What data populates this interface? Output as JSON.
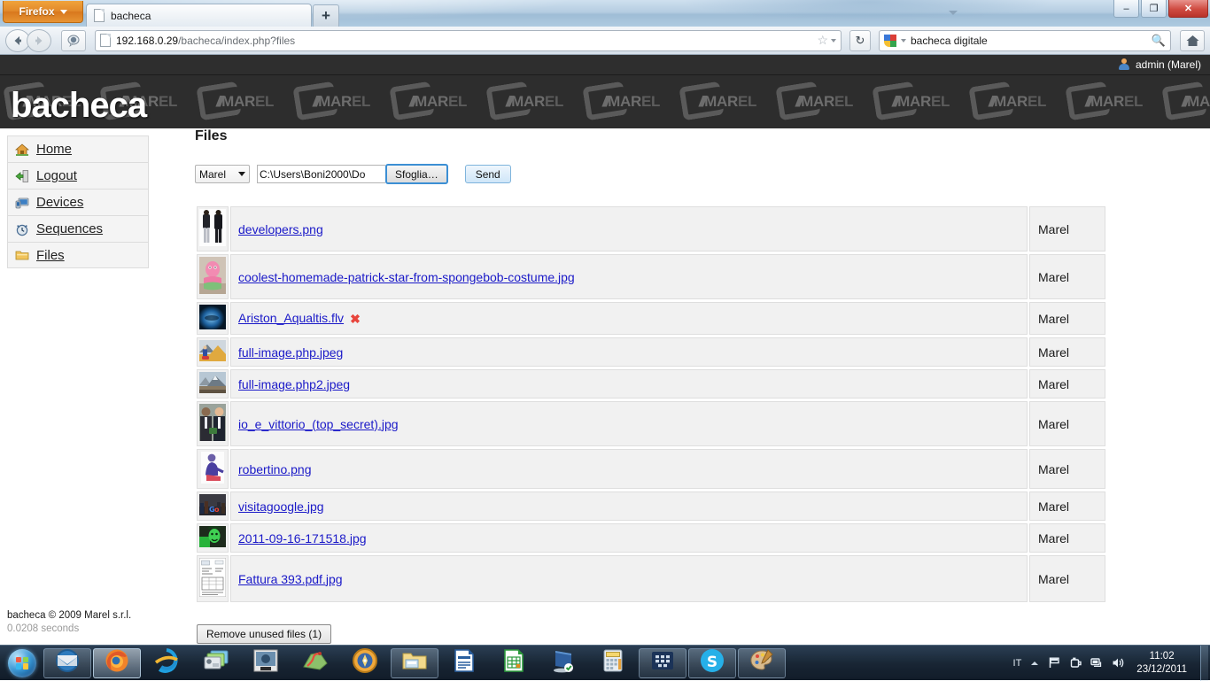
{
  "browser": {
    "app_button": "Firefox",
    "tab_title": "bacheca",
    "newtab_label": "+",
    "url_host": "192.168.0.29",
    "url_path": "/bacheca/index.php?files",
    "search_value": "bacheca digitale",
    "minimize_label": "–",
    "restore_label": "❐",
    "close_label": "✕"
  },
  "adminbar": {
    "user": "admin (Marel)"
  },
  "banner": {
    "title": "bacheca",
    "watermark_slashes": "///",
    "watermark_bold": "MAR",
    "watermark_light": "EL"
  },
  "sidebar": {
    "items": [
      {
        "label": "Home",
        "icon": "home-icon"
      },
      {
        "label": "Logout",
        "icon": "logout-icon"
      },
      {
        "label": "Devices",
        "icon": "devices-icon"
      },
      {
        "label": "Sequences",
        "icon": "sequences-icon"
      },
      {
        "label": "Files",
        "icon": "files-icon"
      }
    ]
  },
  "main": {
    "title": "Files",
    "upload": {
      "owner_selected": "Marel",
      "owner_options": [
        "Marel"
      ],
      "file_path": "C:\\Users\\Boni2000\\Do",
      "browse_label": "Sfoglia…",
      "send_label": "Send"
    },
    "files": [
      {
        "name": "developers.png",
        "owner": "Marel",
        "deletable": false,
        "thumb": "two-people-standing"
      },
      {
        "name": "coolest-homemade-patrick-star-from-spongebob-costume.jpg",
        "owner": "Marel",
        "deletable": false,
        "thumb": "pink-costume"
      },
      {
        "name": "Ariston_Aqualtis.flv",
        "owner": "Marel",
        "deletable": true,
        "thumb": "blue-gradient"
      },
      {
        "name": "full-image.php.jpeg",
        "owner": "Marel",
        "deletable": false,
        "thumb": "person-outdoors"
      },
      {
        "name": "full-image.php2.jpeg",
        "owner": "Marel",
        "deletable": false,
        "thumb": "mountain-scene"
      },
      {
        "name": "io_e_vittorio_(top_secret).jpg",
        "owner": "Marel",
        "deletable": false,
        "thumb": "two-men-suits"
      },
      {
        "name": "robertino.png",
        "owner": "Marel",
        "deletable": false,
        "thumb": "seated-person"
      },
      {
        "name": "visitagoogle.jpg",
        "owner": "Marel",
        "deletable": false,
        "thumb": "google-visit"
      },
      {
        "name": "2011-09-16-171518.jpg",
        "owner": "Marel",
        "deletable": false,
        "thumb": "green-face"
      },
      {
        "name": "Fattura 393.pdf.jpg",
        "owner": "Marel",
        "deletable": false,
        "thumb": "invoice-document"
      }
    ],
    "remove_unused_label": "Remove unused files (1)"
  },
  "footer": {
    "copyright": "bacheca © 2009 Marel s.r.l.",
    "render_time": "0.0208 seconds"
  },
  "taskbar": {
    "items": [
      {
        "name": "thunderbird",
        "state": "pinned"
      },
      {
        "name": "firefox",
        "state": "active"
      },
      {
        "name": "internet-explorer",
        "state": "plain"
      },
      {
        "name": "photo-gallery",
        "state": "plain"
      },
      {
        "name": "camera-viewer",
        "state": "plain"
      },
      {
        "name": "maps",
        "state": "plain"
      },
      {
        "name": "compass",
        "state": "plain"
      },
      {
        "name": "file-explorer",
        "state": "pinned"
      },
      {
        "name": "writer",
        "state": "plain"
      },
      {
        "name": "calc",
        "state": "plain"
      },
      {
        "name": "remote-desktop",
        "state": "plain"
      },
      {
        "name": "calculator",
        "state": "plain"
      },
      {
        "name": "blackberry",
        "state": "pinned"
      },
      {
        "name": "skype",
        "state": "pinned"
      },
      {
        "name": "paint",
        "state": "pinned"
      }
    ],
    "tray": {
      "language": "IT",
      "time": "11:02",
      "date": "23/12/2011"
    }
  },
  "colors": {
    "banner_bg": "#2d2d2d",
    "adminbar_bg": "#2e2e2e",
    "link": "#1a19c8",
    "delete": "#e8453c",
    "row_bg": "#f1f1f1",
    "sidebar_bg": "#f4f4f4",
    "firefox_orange": "#e2892a"
  }
}
